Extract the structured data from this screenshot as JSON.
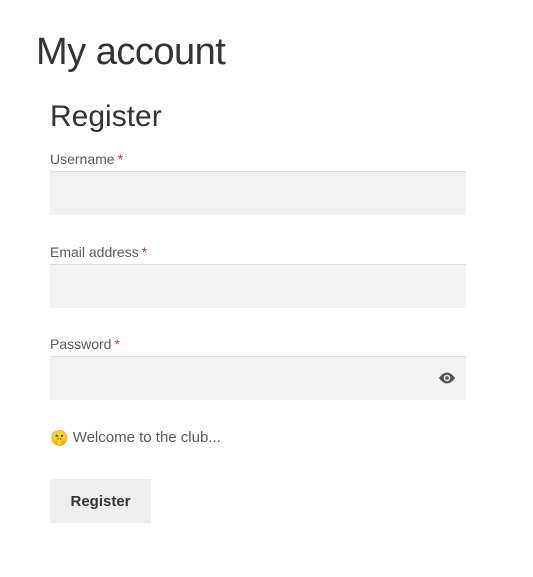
{
  "page": {
    "title": "My account"
  },
  "register": {
    "heading": "Register",
    "required_marker": "*",
    "username": {
      "label": "Username",
      "value": "",
      "placeholder": ""
    },
    "email": {
      "label": "Email address",
      "value": "",
      "placeholder": ""
    },
    "password": {
      "label": "Password",
      "value": "",
      "placeholder": "",
      "toggle_icon": "eye-icon"
    },
    "welcome": {
      "emoji": "🤫",
      "text": "Welcome to the club..."
    },
    "submit_label": "Register"
  },
  "colors": {
    "required": "#c0392b",
    "input_bg": "#f2f2f2",
    "button_bg": "#eeeeee"
  }
}
